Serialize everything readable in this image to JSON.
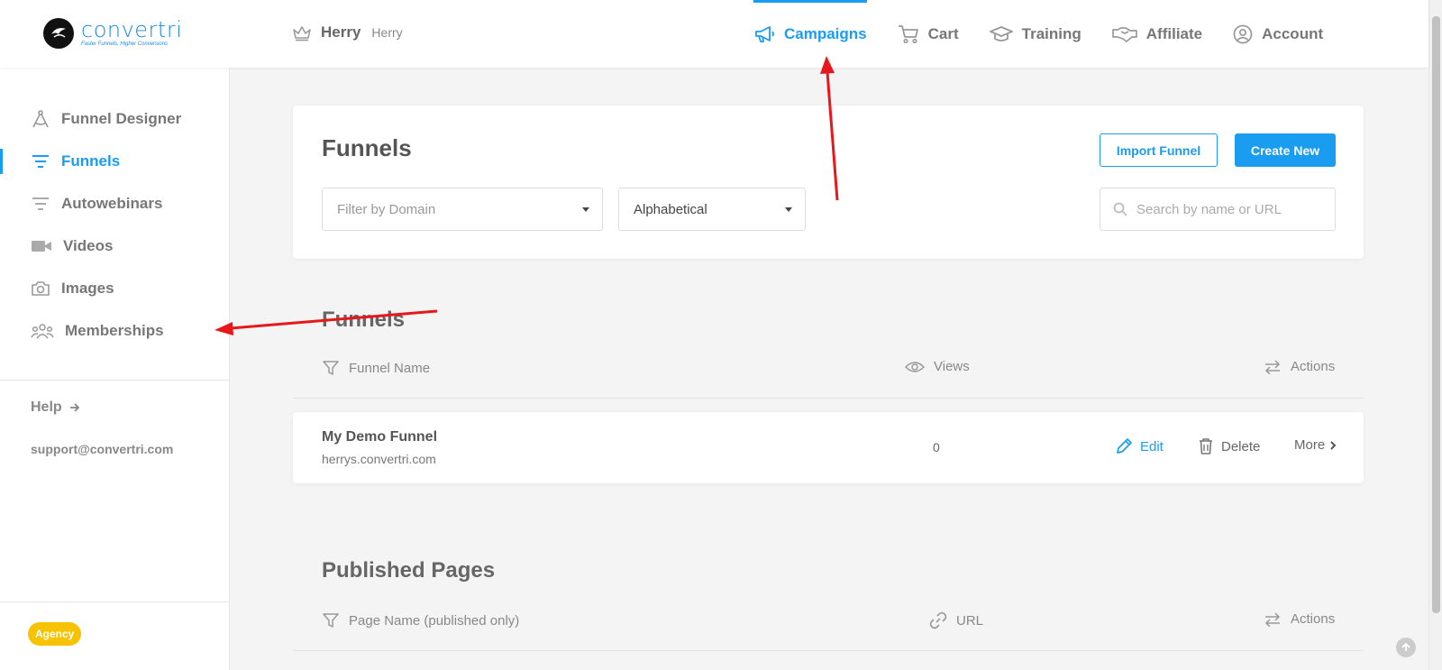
{
  "brand": {
    "name": "convertri",
    "tagline": "Faster Funnels, Higher Conversions"
  },
  "user": {
    "name": "Herry",
    "sub": "Herry"
  },
  "topnav": [
    {
      "label": "Campaigns",
      "icon": "megaphone-icon",
      "active": true
    },
    {
      "label": "Cart",
      "icon": "cart-icon"
    },
    {
      "label": "Training",
      "icon": "graduation-cap-icon"
    },
    {
      "label": "Affiliate",
      "icon": "handshake-icon"
    },
    {
      "label": "Account",
      "icon": "user-circle-icon"
    }
  ],
  "sidebar": {
    "items": [
      {
        "label": "Funnel Designer",
        "icon": "compass-icon"
      },
      {
        "label": "Funnels",
        "icon": "filter-lines-icon",
        "active": true
      },
      {
        "label": "Autowebinars",
        "icon": "filter-lines-icon"
      },
      {
        "label": "Videos",
        "icon": "video-camera-icon"
      },
      {
        "label": "Images",
        "icon": "camera-icon"
      },
      {
        "label": "Memberships",
        "icon": "users-icon"
      }
    ],
    "help": "Help",
    "support_email": "support@convertri.com",
    "badge": "Agency"
  },
  "funnels_card": {
    "title": "Funnels",
    "import_label": "Import Funnel",
    "create_label": "Create New",
    "domain_filter_placeholder": "Filter by Domain",
    "sort_value": "Alphabetical",
    "search_placeholder": "Search by name or URL"
  },
  "funnels_list": {
    "title": "Funnels",
    "columns": {
      "name": "Funnel Name",
      "views": "Views",
      "actions": "Actions"
    },
    "rows": [
      {
        "name": "My Demo Funnel",
        "url": "herrys.convertri.com",
        "views": "0",
        "edit": "Edit",
        "delete": "Delete",
        "more": "More"
      }
    ]
  },
  "published_pages": {
    "title": "Published Pages",
    "columns": {
      "name": "Page Name (published only)",
      "url": "URL",
      "actions": "Actions"
    }
  },
  "colors": {
    "accent": "#1a9cf0",
    "badge": "#f7c300",
    "annotation": "#e8171b"
  }
}
